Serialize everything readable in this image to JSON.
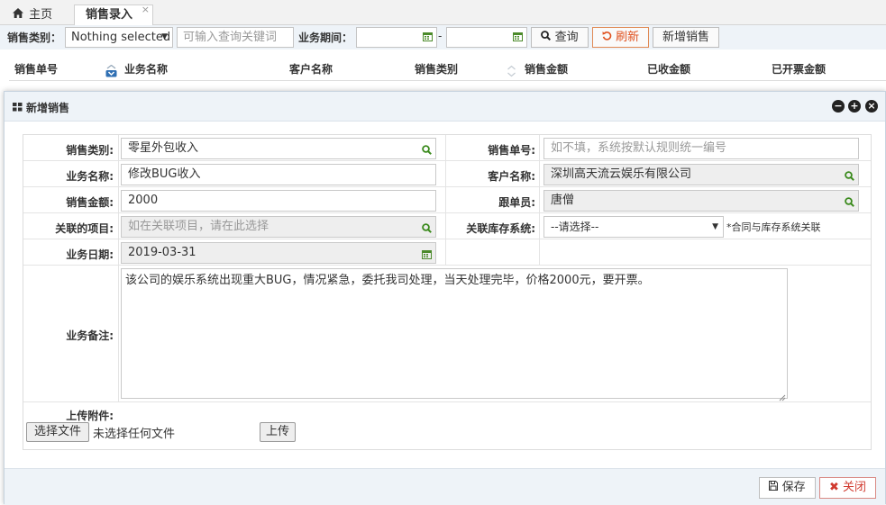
{
  "tabs": {
    "home_label": "主页",
    "active_label": "销售录入",
    "close_glyph": "×"
  },
  "filter": {
    "category_label": "销售类别：",
    "category_value": "Nothing selected",
    "keyword_placeholder": "可输入查询关键词",
    "period_label": "业务期间：",
    "date_separator": "-",
    "query_button": "查询",
    "refresh_button": "刷新",
    "add_button": "新增销售"
  },
  "grid": {
    "columns": [
      "销售单号",
      "业务名称",
      "客户名称",
      "销售类别",
      "销售金额",
      "已收金额",
      "已开票金额"
    ]
  },
  "modal": {
    "title": "新增销售",
    "fields": {
      "sales_category_label": "销售类别:",
      "sales_category_value": "零星外包收入",
      "sales_no_label": "销售单号:",
      "sales_no_placeholder": "如不填，系统按默认规则统一编号",
      "business_name_label": "业务名称:",
      "business_name_value": "修改BUG收入",
      "customer_label": "客户名称:",
      "customer_value": "深圳高天流云娱乐有限公司",
      "amount_label": "销售金额:",
      "amount_value": "2000",
      "follower_label": "跟单员:",
      "follower_value": "唐僧",
      "project_label": "关联的项目:",
      "project_placeholder": "如在关联项目，请在此选择",
      "inventory_label": "关联库存系统:",
      "inventory_value": "--请选择--",
      "inventory_note": "*合同与库存系统关联",
      "date_label": "业务日期:",
      "date_value": "2019-03-31",
      "remark_label": "业务备注:",
      "remark_value": "该公司的娱乐系统出现重大BUG，情况紧急，委托我司处理，当天处理完毕，价格2000元，要开票。",
      "attach_label": "上传附件:",
      "choose_file_button": "选择文件",
      "no_file_text": "未选择任何文件",
      "upload_button": "上传"
    },
    "save_button": "保存",
    "close_button": "关闭"
  },
  "colors": {
    "accent_green": "#3a8a1c",
    "refresh_orange": "#e0501d",
    "close_red": "#d03a2f",
    "header_bg": "#eef3f8",
    "sort_blue": "#2f6fb3"
  }
}
